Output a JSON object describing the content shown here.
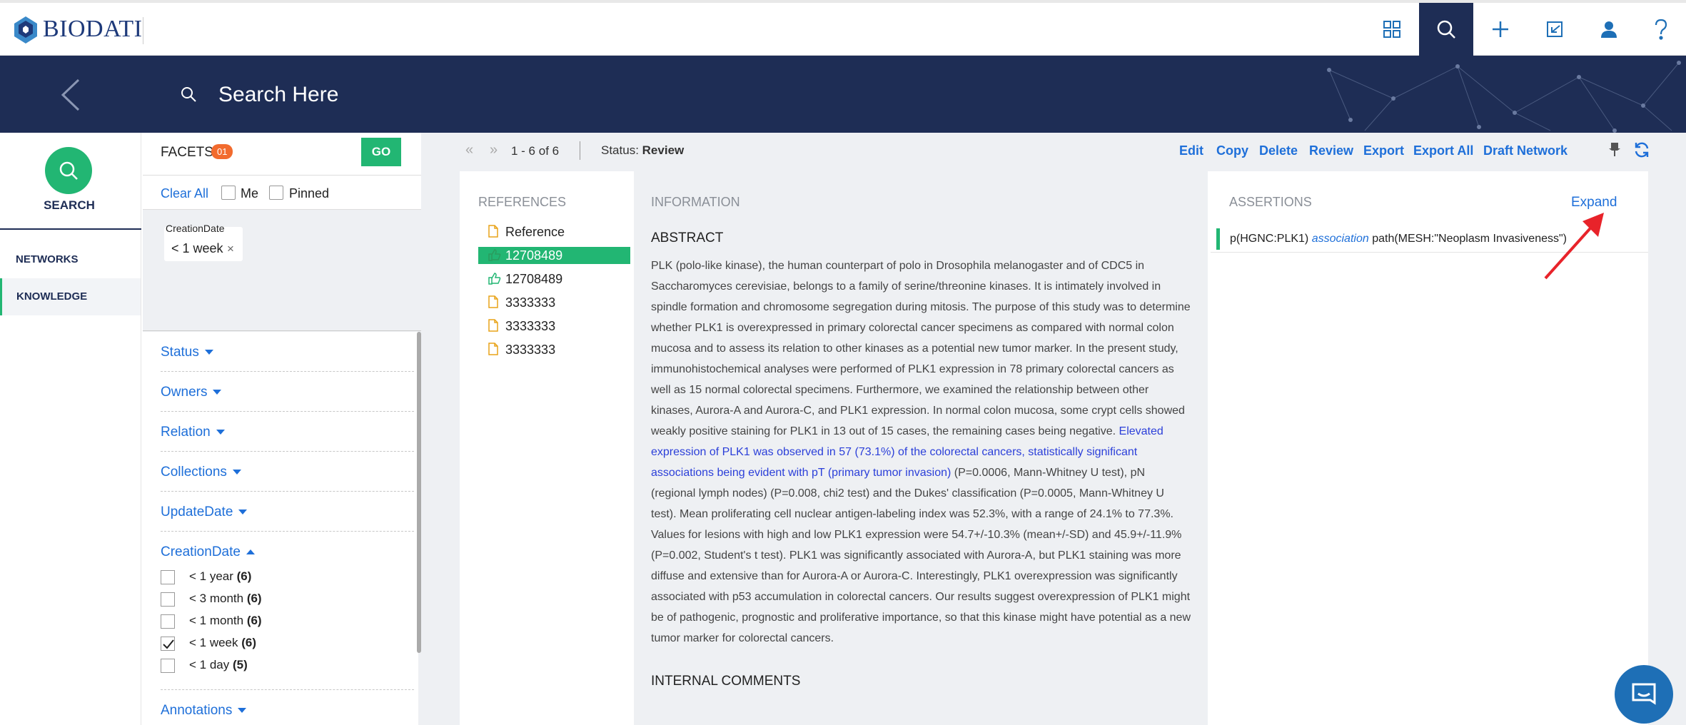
{
  "app": {
    "logo_text": "BIODATI",
    "logo_accent": "DATI"
  },
  "topnav": {
    "icons": [
      "apps-grid-icon",
      "search-icon",
      "plus-icon",
      "import-icon",
      "user-icon",
      "help-icon"
    ],
    "active": "search-icon"
  },
  "search": {
    "placeholder": "Search Here"
  },
  "leftnav": {
    "search_label": "SEARCH",
    "items": [
      {
        "label": "NETWORKS",
        "active": false
      },
      {
        "label": "KNOWLEDGE",
        "active": true
      }
    ]
  },
  "facets": {
    "title": "FACETS",
    "count": "01",
    "go_label": "GO",
    "clear_all": "Clear All",
    "me_label": "Me",
    "pinned_label": "Pinned",
    "chip": {
      "title": "CreationDate",
      "value": "< 1 week",
      "remove": "×"
    },
    "groups": [
      "Status",
      "Owners",
      "Relation",
      "Collections",
      "UpdateDate",
      "CreationDate",
      "Annotations"
    ],
    "expanded_group": "CreationDate",
    "creation_options": [
      {
        "label": "< 1 year",
        "count": "(6)",
        "checked": false
      },
      {
        "label": "< 3 month",
        "count": "(6)",
        "checked": false
      },
      {
        "label": "< 1 month",
        "count": "(6)",
        "checked": false
      },
      {
        "label": "< 1 week",
        "count": "(6)",
        "checked": true
      },
      {
        "label": "< 1 day",
        "count": "(5)",
        "checked": false
      }
    ]
  },
  "toolbar": {
    "first": "«",
    "next": "»",
    "range": "1 - 6 of 6",
    "status_label": "Status:",
    "status_value": "Review",
    "actions": [
      "Edit",
      "Copy",
      "Delete",
      "Review",
      "Export",
      "Export All",
      "Draft Network"
    ],
    "icons": [
      "pin-icon",
      "refresh-icon"
    ]
  },
  "references": {
    "title": "REFERENCES",
    "items": [
      {
        "label": "Reference",
        "icon": "document-icon",
        "selected": false
      },
      {
        "label": "12708489",
        "icon": "thumbs-up-icon",
        "selected": true
      },
      {
        "label": "12708489",
        "icon": "thumbs-up-icon",
        "selected": false
      },
      {
        "label": "3333333",
        "icon": "document-icon",
        "selected": false
      },
      {
        "label": "3333333",
        "icon": "document-icon",
        "selected": false
      },
      {
        "label": "3333333",
        "icon": "document-icon",
        "selected": false
      }
    ]
  },
  "information": {
    "title": "INFORMATION",
    "abstract_heading": "ABSTRACT",
    "abstract_part1": "PLK (polo-like kinase), the human counterpart of polo in Drosophila melanogaster and of CDC5 in Saccharomyces cerevisiae, belongs to a family of serine/threonine kinases. It is intimately involved in spindle formation and chromosome segregation during mitosis. The purpose of this study was to determine whether PLK1 is overexpressed in primary colorectal cancer specimens as compared with normal colon mucosa and to assess its relation to other kinases as a potential new tumor marker. In the present study, immunohistochemical analyses were performed of PLK1 expression in 78 primary colorectal cancers as well as 15 normal colorectal specimens. Furthermore, we examined the relationship between other kinases, Aurora-A and Aurora-C, and PLK1 expression. In normal colon mucosa, some crypt cells showed weakly positive staining for PLK1 in 13 out of 15 cases, the remaining cases being negative.",
    "abstract_highlight": "Elevated expression of PLK1 was observed in 57 (73.1%) of the colorectal cancers, statistically significant associations being evident with pT (primary tumor invasion)",
    "abstract_part2": "(P=0.0006, Mann-Whitney U test), pN (regional lymph nodes) (P=0.008, chi2 test) and the Dukes' classification (P=0.0005, Mann-Whitney U test). Mean proliferating cell nuclear antigen-labeling index was 52.3%, with a range of 24.1% to 77.3%. Values for lesions with high and low PLK1 expression were 54.7+/-10.3% (mean+/-SD) and 45.9+/-11.9% (P=0.002, Student's t test). PLK1 was significantly associated with Aurora-A, but PLK1 staining was more diffuse and extensive than for Aurora-A or Aurora-C. Interestingly, PLK1 overexpression was significantly associated with p53 accumulation in colorectal cancers. Our results suggest overexpression of PLK1 might be of pathogenic, prognostic and proliferative importance, so that this kinase might have potential as a new tumor marker for colorectal cancers.",
    "internal_comments_heading": "INTERNAL COMMENTS"
  },
  "assertions": {
    "title": "ASSERTIONS",
    "expand_label": "Expand",
    "items": [
      {
        "subject": "p(HGNC:PLK1)",
        "relation": "association",
        "object": "path(MESH:\"Neoplasm Invasiveness\")"
      }
    ]
  },
  "colors": {
    "navy": "#1e2d55",
    "green": "#22b673",
    "link_blue": "#1e6fd9",
    "badge_orange": "#f26b2e",
    "annotation_arrow": "#e8232a"
  }
}
